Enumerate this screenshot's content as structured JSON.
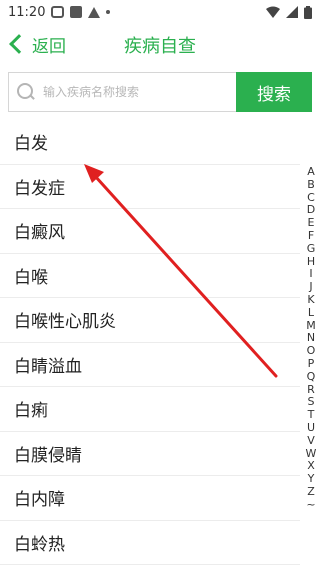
{
  "status_bar": {
    "time": "11:20"
  },
  "header": {
    "back_label": "返回",
    "title": "疾病自查"
  },
  "search": {
    "placeholder": "输入疾病名称搜索",
    "value": "",
    "button_label": "搜索"
  },
  "diseases": [
    "白发",
    "白发症",
    "白癜风",
    "白喉",
    "白喉性心肌炎",
    "白睛溢血",
    "白痢",
    "白膜侵睛",
    "白内障",
    "白蛉热"
  ],
  "index_letters": [
    "A",
    "B",
    "C",
    "D",
    "E",
    "F",
    "G",
    "H",
    "I",
    "J",
    "K",
    "L",
    "M",
    "N",
    "O",
    "P",
    "Q",
    "R",
    "S",
    "T",
    "U",
    "V",
    "W",
    "X",
    "Y",
    "Z",
    "~"
  ],
  "colors": {
    "accent": "#2bb04f",
    "annotation_arrow": "#e02020"
  }
}
